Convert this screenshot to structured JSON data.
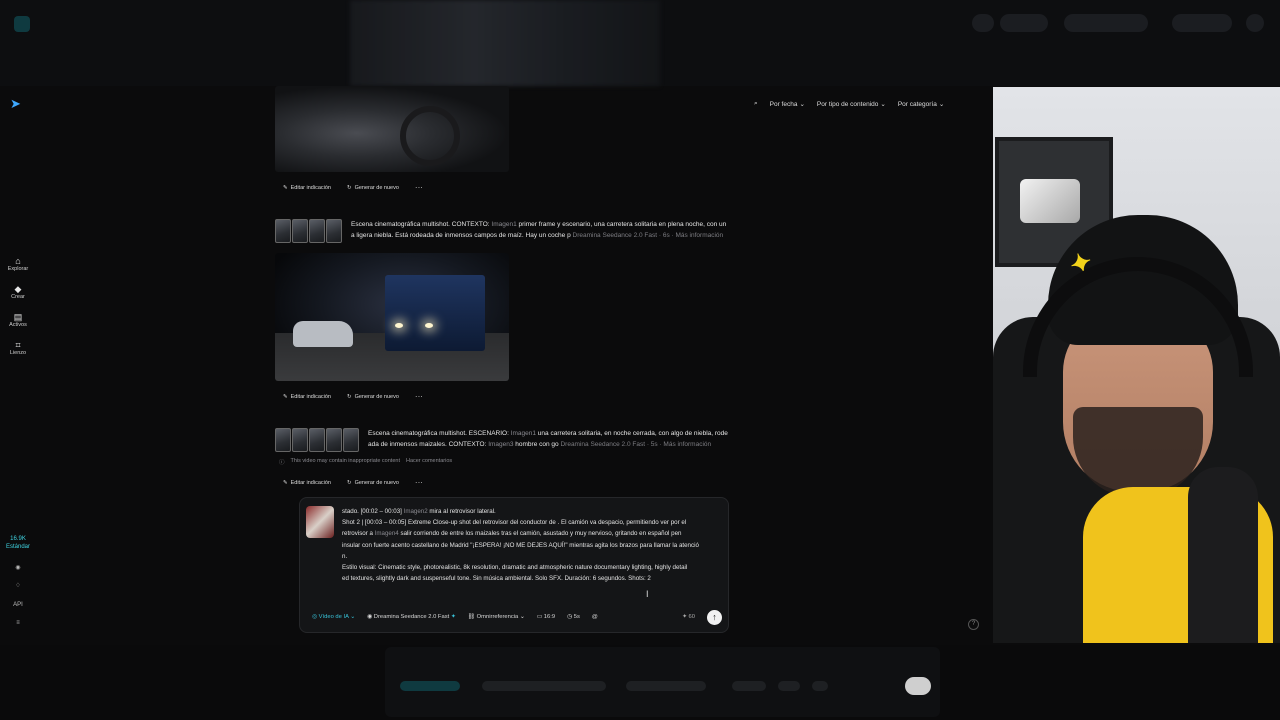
{
  "filters": {
    "by_date": "Por fecha",
    "by_content_type": "Por tipo de contenido",
    "by_category": "Por categoría"
  },
  "sidebar": {
    "items": [
      {
        "label": "Explorar"
      },
      {
        "label": "Crear"
      },
      {
        "label": "Activos"
      },
      {
        "label": "Lienzo"
      }
    ],
    "credits_value": "16.9K",
    "credits_label": "Estándar",
    "api_label": "API"
  },
  "actions": {
    "edit": "Editar indicación",
    "regenerate": "Generar de nuevo",
    "more": "···"
  },
  "prompt1": {
    "line1_a": "Escena cinematográfica multishot. CONTEXTO: ",
    "line1_tag": "Imagen1",
    "line1_b": " primer frame y escenario, una carretera solitaria en plena noche, con un",
    "line2_a": "a ligera niebla. Está rodeada de inmensos campos de maíz. Hay un coche p",
    "line2_meta": "Dreamina Seedance 2.0 Fast · 6s · Más información"
  },
  "prompt2": {
    "line1_a": "Escena cinematográfica multishot. ESCENARIO: ",
    "line1_tag": "Imagen1",
    "line1_b": " una carretera solitaria, en noche cerrada, con algo de niebla, rode",
    "line2_a": "ada de inmensos maizales. CONTEXTO: ",
    "line2_tag": "Imagen3",
    "line2_b": " hombre con go",
    "line2_meta": "Dreamina Seedance 2.0 Fast · 5s · Más información"
  },
  "warning": {
    "text": "This video may contain inappropriate content",
    "link": "Hacer comentarios"
  },
  "composer": {
    "line1_a": "stado. [00:02 – 00:03] ",
    "line1_tag": "Imagen2",
    "line1_b": " mira al retrovisor lateral.",
    "line2_a": "Shot 2 | [00:03 – 00:05] Extreme Close-up shot del retrovisor del conductor de . El camión va despacio, permitiendo ver por el",
    "line3_a": "retrovisor a ",
    "line3_tag": "Imagen4",
    "line3_b": " salir corriendo de entre los maizales tras el camión, asustado y muy nervioso, gritando en español pen",
    "line4_a": "insular con fuerte acento castellano de Madrid \"¡ESPERA! ¡NO ME DEJES AQUÍ!\" mientras agita los brazos para llamar la atenció",
    "line5_a": "n.",
    "line6_a": "Estilo visual: Cinematic style, photorealistic, 8k resolution, dramatic and atmospheric nature documentary lighting, highly detail",
    "line7_a": "ed textures, slightly dark and suspenseful tone. Sin música ambiental. Solo SFX. Duración: 6 segundos. Shots: 2",
    "toolbar": {
      "mode": "Vídeo de IA",
      "model": "Dreamina Seedance 2.0 Fast",
      "reference": "Omnirreferencia",
      "ratio": "16:9",
      "duration": "5s",
      "credits": "60"
    }
  },
  "colors": {
    "accent": "#38c2d8",
    "logo": "#3fa9ff",
    "shirt": "#f0c31c"
  }
}
